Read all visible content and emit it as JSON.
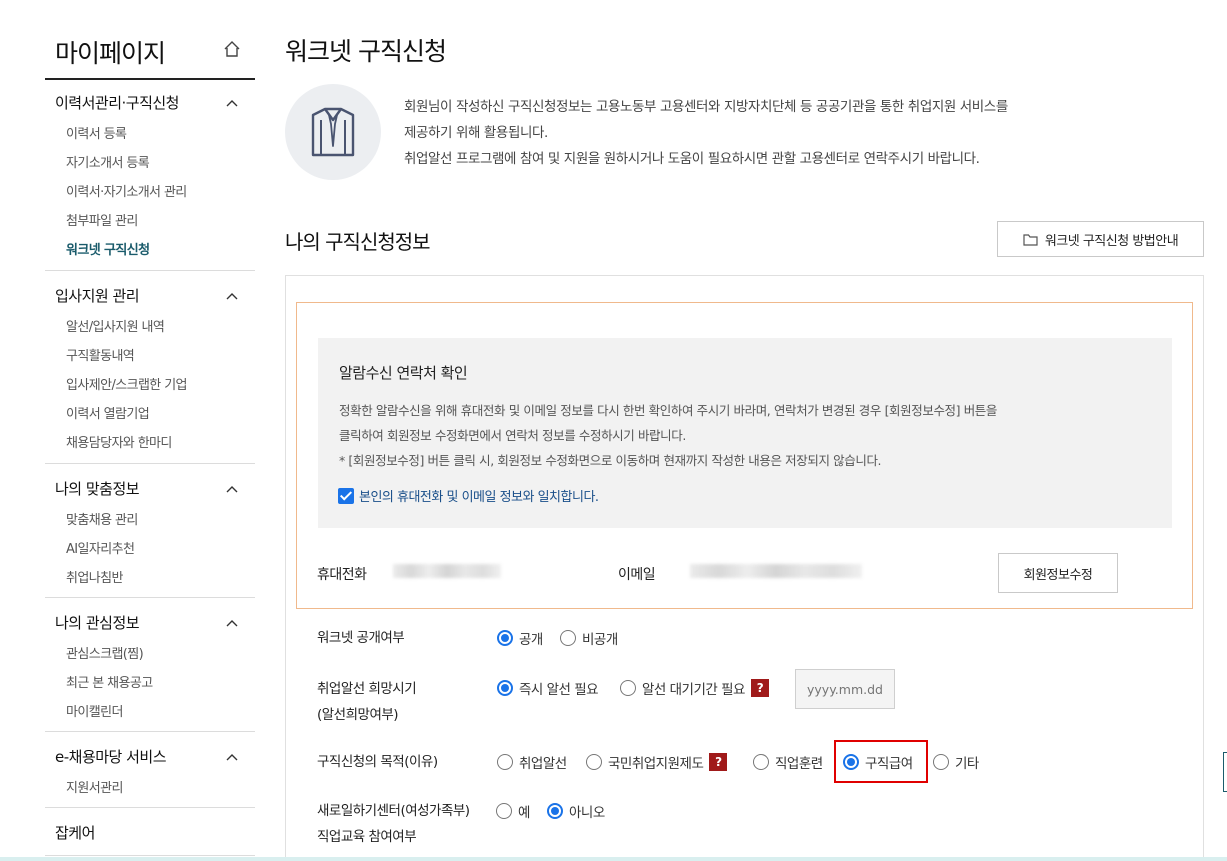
{
  "sidebar": {
    "title": "마이페이지",
    "groups": [
      {
        "title": "이력서관리·구직신청",
        "items": [
          "이력서 등록",
          "자기소개서 등록",
          "이력서·자기소개서 관리",
          "첨부파일 관리",
          "워크넷 구직신청"
        ]
      },
      {
        "title": "입사지원 관리",
        "items": [
          "알선/입사지원 내역",
          "구직활동내역",
          "입사제안/스크랩한 기업",
          "이력서 열람기업",
          "채용담당자와 한마디"
        ]
      },
      {
        "title": "나의 맞춤정보",
        "items": [
          "맞춤채용 관리",
          "AI일자리추천",
          "취업나침반"
        ]
      },
      {
        "title": "나의 관심정보",
        "items": [
          "관심스크랩(찜)",
          "최근 본 채용공고",
          "마이캘린더"
        ]
      },
      {
        "title": "e-채용마당 서비스",
        "items": [
          "지원서관리"
        ]
      },
      {
        "title": "잡케어",
        "items": []
      }
    ],
    "active_item": "워크넷 구직신청"
  },
  "main": {
    "page_title": "워크넷 구직신청",
    "intro": [
      "회원님이 작성하신 구직신청정보는 고용노동부 고용센터와 지방자치단체 등 공공기관을 통한 취업지원 서비스를",
      "제공하기 위해 활용됩니다.",
      "취업알선 프로그램에 참여 및 지원을 원하시거나 도움이 필요하시면 관할 고용센터로 연락주시기 바랍니다."
    ],
    "section_title": "나의 구직신청정보",
    "guide_button": "워크넷 구직신청 방법안내",
    "notice": {
      "title": "알람수신 연락처 확인",
      "lines": [
        "정확한 알람수신을 위해 휴대전화 및 이메일 정보를 다시 한번 확인하여 주시기 바라며, 연락처가 변경된 경우 [회원정보수정] 버튼을",
        "클릭하여 회원정보 수정화면에서 연락처 정보를 수정하시기 바랍니다.",
        "* [회원정보수정] 버튼 클릭 시, 회원정보 수정화면으로 이동하며 현재까지 작성한 내용은 저장되지 않습니다."
      ],
      "agree_label": "본인의 휴대전화 및 이메일 정보와 일치합니다.",
      "agree_checked": true
    },
    "contact": {
      "phone_label": "휴대전화",
      "email_label": "이메일",
      "edit_button": "회원정보수정"
    },
    "form": {
      "public": {
        "label": "워크넷 공개여부",
        "options": [
          "공개",
          "비공개"
        ],
        "selected": "공개"
      },
      "timing": {
        "label": [
          "취업알선 희망시기",
          "(알선희망여부)"
        ],
        "options": [
          "즉시 알선 필요",
          "알선 대기기간 필요"
        ],
        "selected": "즉시 알선 필요",
        "date_placeholder": "yyyy.mm.dd"
      },
      "purpose": {
        "label": "구직신청의 목적(이유)",
        "options": [
          "취업알선",
          "국민취업지원제도",
          "직업훈련",
          "구직급여",
          "기타"
        ],
        "selected": "구직급여"
      },
      "women_center": {
        "label": [
          "새로일하기센터(여성가족부)",
          "직업교육 참여여부"
        ],
        "options": [
          "예",
          "아니오"
        ],
        "selected": "아니오"
      }
    },
    "help_mark": "?"
  }
}
